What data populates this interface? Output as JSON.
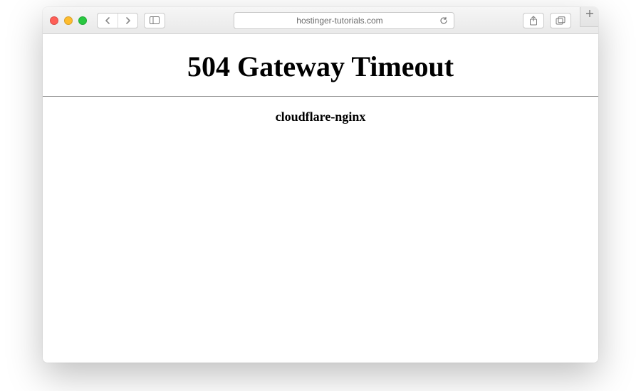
{
  "browser": {
    "address": "hostinger-tutorials.com"
  },
  "page": {
    "error_title": "504 Gateway Timeout",
    "server_line": "cloudflare-nginx"
  }
}
